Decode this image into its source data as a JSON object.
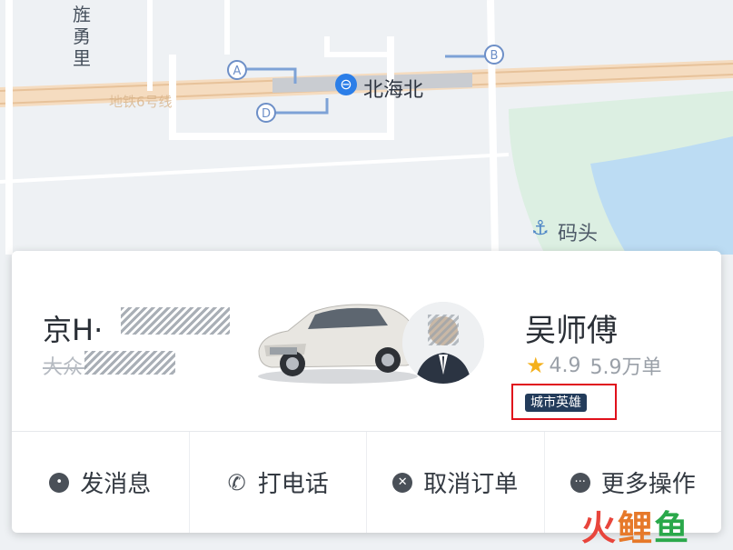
{
  "map": {
    "district": "旌勇里",
    "road": "地铁6号线",
    "station": "北海北",
    "metro_icon": "⊖",
    "exits": [
      "A",
      "B",
      "D"
    ],
    "dock": "码头",
    "dock_icon": "⚓"
  },
  "vehicle": {
    "plate": "京H·",
    "model": "大众·"
  },
  "driver": {
    "name": "吴师傅",
    "rating": "4.9",
    "orders": "5.9万单",
    "badge": "城市英雄"
  },
  "actions": [
    {
      "label": "发消息",
      "icon": "message-icon"
    },
    {
      "label": "打电话",
      "icon": "phone-icon"
    },
    {
      "label": "取消订单",
      "icon": "cancel-icon"
    },
    {
      "label": "更多操作",
      "icon": "more-icon"
    }
  ],
  "watermark": {
    "c1": "火",
    "c2": "鲤",
    "c3": "鱼"
  },
  "colors": {
    "badge_bg": "#233c5b",
    "highlight": "#e0101b",
    "metro": "#2b7ee8",
    "star": "#f4b01b"
  }
}
